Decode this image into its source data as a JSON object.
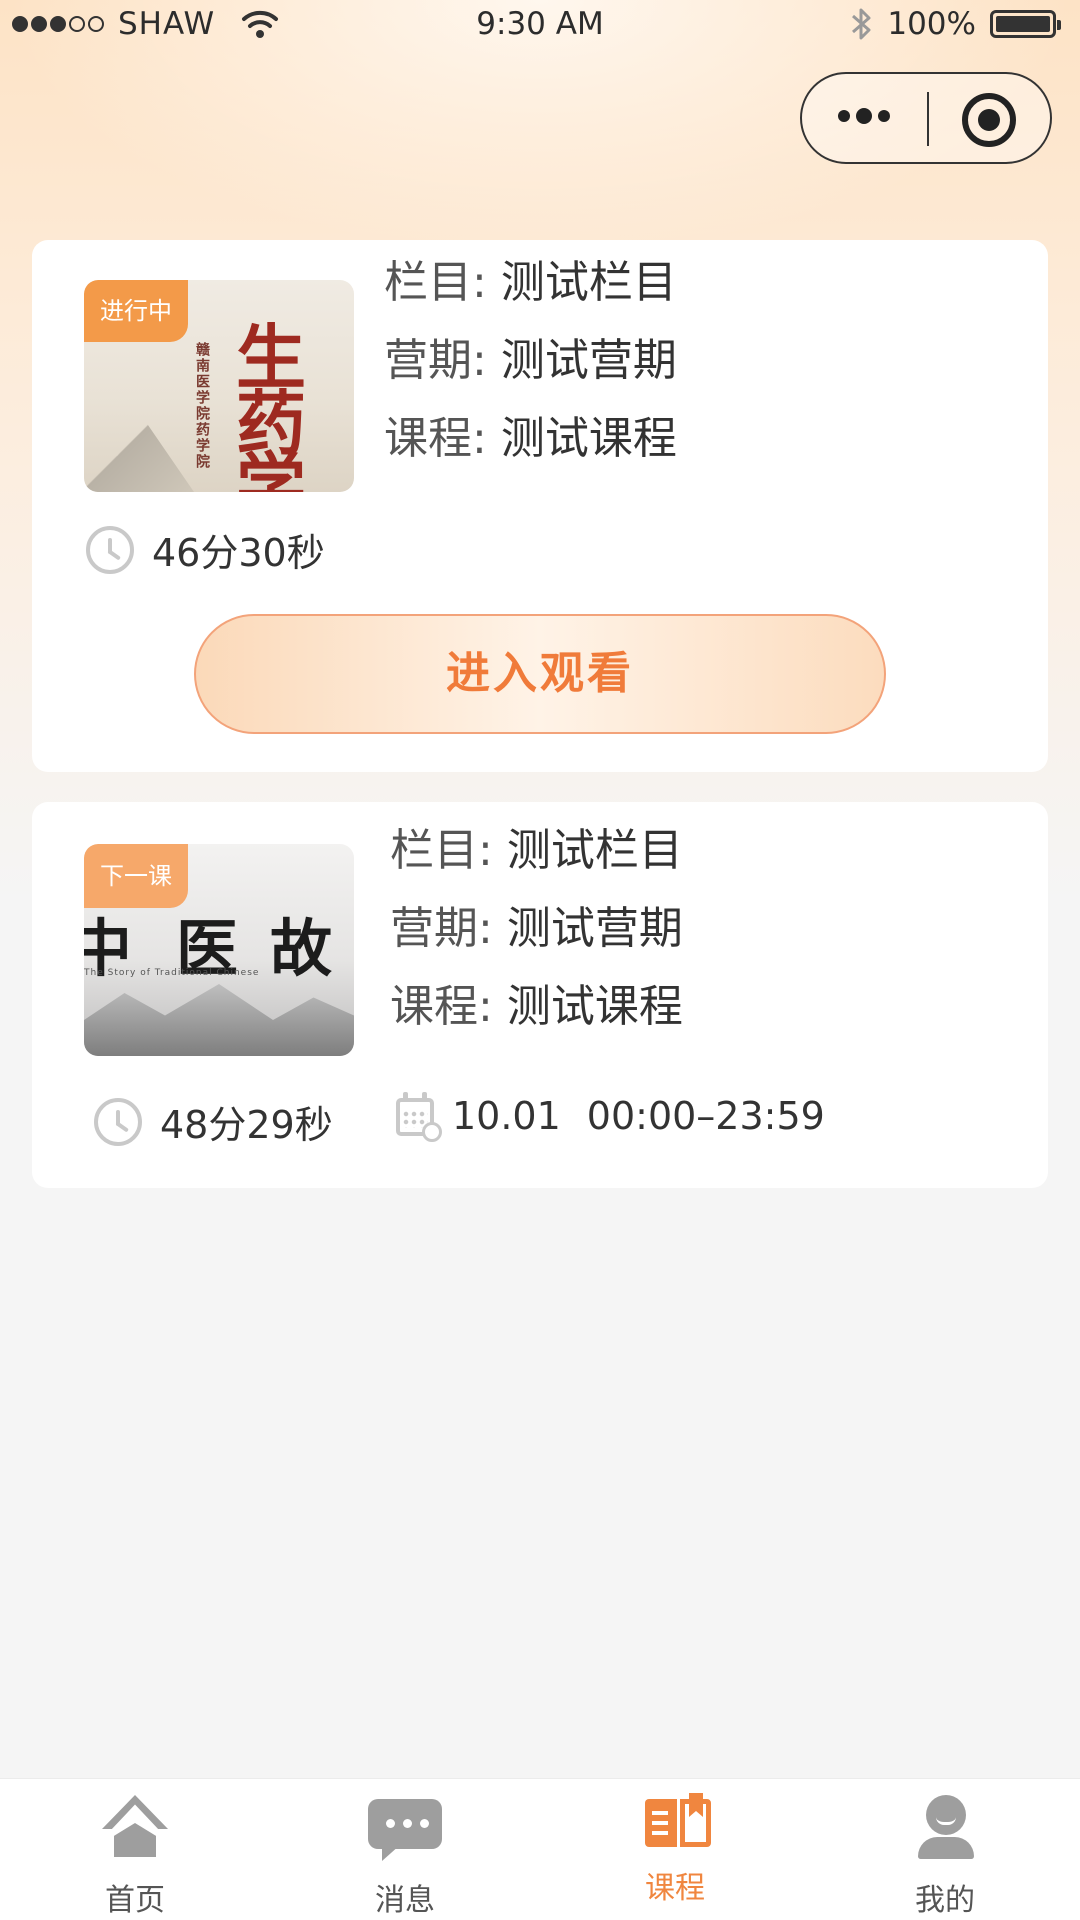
{
  "status_bar": {
    "carrier": "SHAW",
    "time": "9:30 AM",
    "battery": "100%"
  },
  "cards": [
    {
      "badge": "进行中",
      "thumb_title": [
        "生",
        "药",
        "学"
      ],
      "thumb_subtitle": "赣南医学院药学院",
      "column_label": "栏目:",
      "column_value": "测试栏目",
      "camp_label": "营期:",
      "camp_value": "测试营期",
      "course_label": "课程:",
      "course_value": "测试课程",
      "duration": "46分30秒",
      "action_label": "进入观看"
    },
    {
      "badge": "下一课",
      "thumb_title": [
        "中",
        "医",
        "故"
      ],
      "thumb_subtitle": "The Story of Traditional Chinese",
      "column_label": "栏目:",
      "column_value": "测试栏目",
      "camp_label": "营期:",
      "camp_value": "测试营期",
      "course_label": "课程:",
      "course_value": "测试课程",
      "duration": "48分29秒",
      "date": "10.01",
      "time_range": "00:00–23:59"
    }
  ],
  "tabbar": [
    {
      "label": "首页",
      "icon": "home-icon"
    },
    {
      "label": "消息",
      "icon": "message-icon"
    },
    {
      "label": "课程",
      "icon": "course-icon",
      "active": true
    },
    {
      "label": "我的",
      "icon": "profile-icon"
    }
  ],
  "colors": {
    "accent": "#f0863f",
    "badge_active": "#f39a49",
    "badge_next": "#f6a86a",
    "icon_gray": "#9e9e9e"
  }
}
